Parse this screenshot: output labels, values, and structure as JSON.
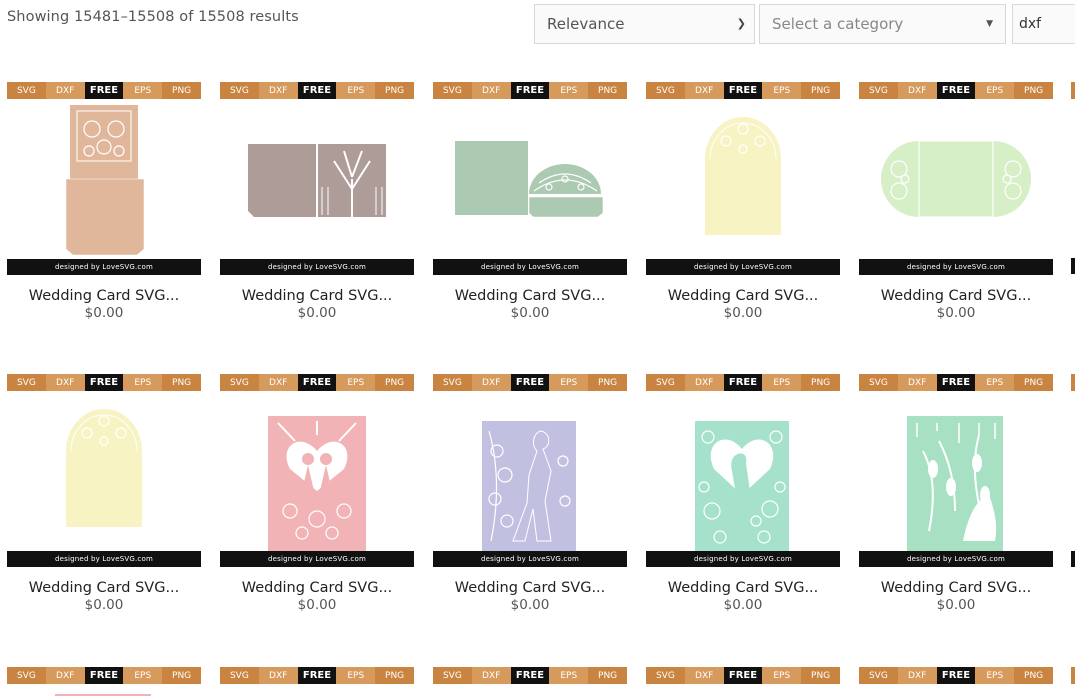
{
  "toolbar": {
    "results_text": "Showing 15481–15508 of 15508 results",
    "sort_value": "Relevance",
    "category_placeholder": "Select a category",
    "search_value": "dxf"
  },
  "format_labels": [
    "SVG",
    "DXF",
    "FREE",
    "EPS",
    "PNG"
  ],
  "credit_text": "designed by LoveSVG.com",
  "products": [
    {
      "title": "Wedding Card SVG...",
      "price": "$0.00",
      "color": "#e0b79b",
      "shape": "pocket"
    },
    {
      "title": "Wedding Card SVG...",
      "price": "$0.00",
      "color": "#ad9c98",
      "shape": "tree-fold"
    },
    {
      "title": "Wedding Card SVG...",
      "price": "$0.00",
      "color": "#acc9b1",
      "shape": "arch-fold"
    },
    {
      "title": "Wedding Card SVG...",
      "price": "$0.00",
      "color": "#f7f3c3",
      "shape": "arch"
    },
    {
      "title": "Wedding Card SVG...",
      "price": "$0.00",
      "color": "#d6efc6",
      "shape": "gatefold"
    },
    {
      "title": "Wedding Card SVG...",
      "price": "$0.00",
      "color": "#f7f3c3",
      "shape": "arch"
    },
    {
      "title": "Wedding Card SVG...",
      "price": "$0.00",
      "color": "#f2b3b6",
      "shape": "couple-heart"
    },
    {
      "title": "Wedding Card SVG...",
      "price": "$0.00",
      "color": "#c2c0e1",
      "shape": "couple-floral"
    },
    {
      "title": "Wedding Card SVG...",
      "price": "$0.00",
      "color": "#a6e2cb",
      "shape": "couple-heart2"
    },
    {
      "title": "Wedding Card SVG...",
      "price": "$0.00",
      "color": "#a8e0c3",
      "shape": "vines"
    },
    {
      "title": "",
      "price": "",
      "color": "#f2b3b6",
      "shape": "partial"
    },
    {
      "title": "",
      "price": "",
      "color": "",
      "shape": "partial"
    },
    {
      "title": "",
      "price": "",
      "color": "",
      "shape": "partial"
    },
    {
      "title": "",
      "price": "",
      "color": "",
      "shape": "partial"
    },
    {
      "title": "",
      "price": "",
      "color": "",
      "shape": "partial"
    }
  ],
  "colors": {
    "format_orange": "#c98441",
    "format_free": "#111111",
    "credit_bar": "#111111"
  }
}
